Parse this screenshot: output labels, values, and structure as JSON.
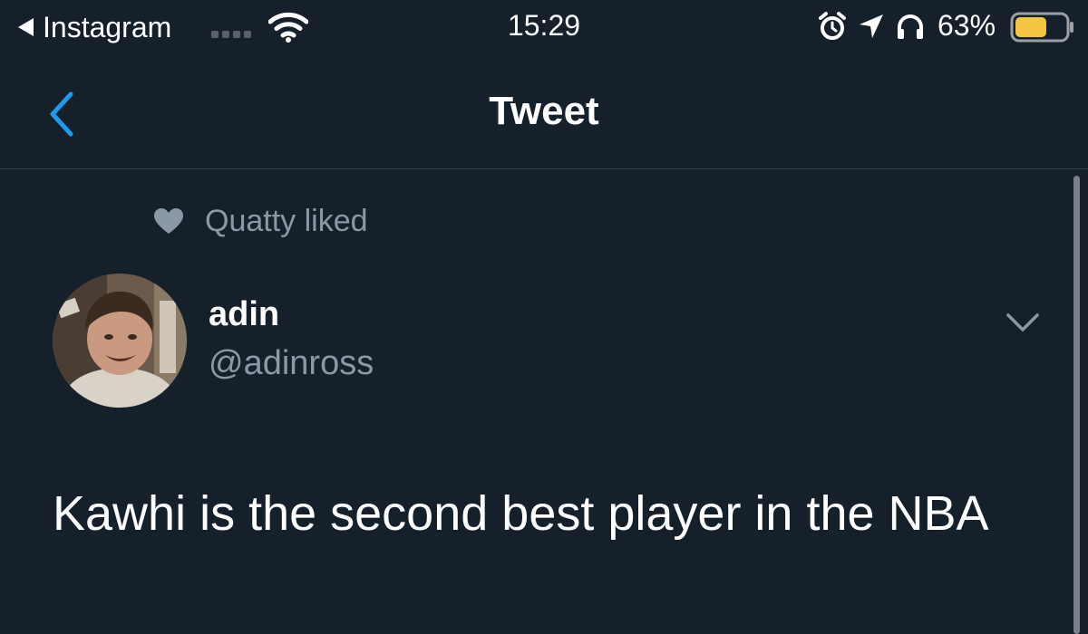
{
  "status_bar": {
    "back_app_label": "Instagram",
    "time": "15:29",
    "battery_percent": "63%",
    "icons": [
      "back-arrow-icon",
      "cellular-signal-icon",
      "wifi-icon",
      "alarm-icon",
      "location-arrow-icon",
      "headphones-icon",
      "battery-icon"
    ],
    "battery_level": 0.63,
    "battery_color": "#f4c542"
  },
  "nav": {
    "title": "Tweet",
    "back_icon": "chevron-left-icon",
    "accent_color": "#1d9bf0"
  },
  "tweet": {
    "social_context": "Quatty liked",
    "social_context_icon": "heart-icon",
    "author": {
      "name": "adin",
      "handle": "@adinross"
    },
    "menu_icon": "chevron-down-icon",
    "text": "Kawhi is the second best player in the NBA"
  },
  "theme": {
    "background": "#15202b",
    "secondary_text": "#8b98a5",
    "divider": "#38444d"
  }
}
